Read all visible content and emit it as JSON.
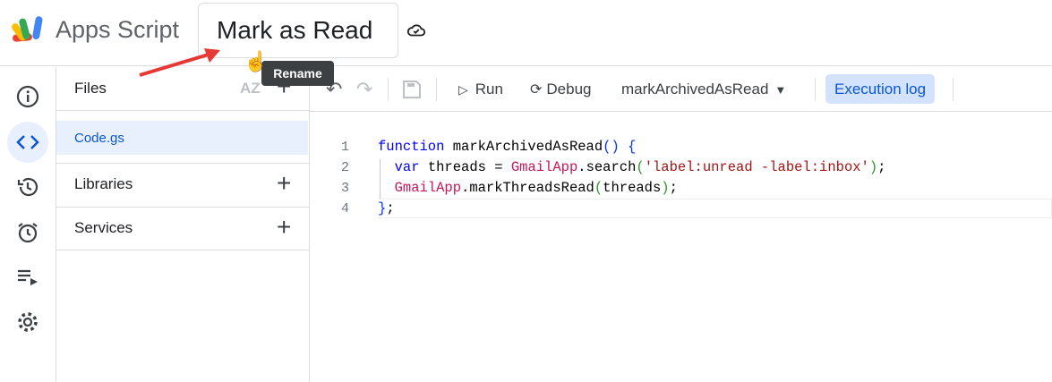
{
  "header": {
    "app_name": "Apps Script",
    "project_title": "Mark as Read",
    "tooltip": "Rename"
  },
  "sidebar": {
    "files_label": "Files",
    "sort_label": "AZ",
    "files": [
      {
        "name": "Code.gs",
        "selected": true
      }
    ],
    "libraries_label": "Libraries",
    "services_label": "Services"
  },
  "toolbar": {
    "run_label": "Run",
    "debug_label": "Debug",
    "function_select": "markArchivedAsRead",
    "execution_log_label": "Execution log"
  },
  "editor": {
    "line_numbers": [
      "1",
      "2",
      "3",
      "4"
    ],
    "lines": [
      [
        {
          "t": "function",
          "c": "kw"
        },
        {
          "t": " markArchivedAsRead",
          "c": ""
        },
        {
          "t": "()",
          "c": "pb"
        },
        {
          "t": " ",
          "c": ""
        },
        {
          "t": "{",
          "c": "pb"
        }
      ],
      [
        {
          "t": "  ",
          "c": ""
        },
        {
          "t": "var",
          "c": "kw"
        },
        {
          "t": " threads = ",
          "c": ""
        },
        {
          "t": "GmailApp",
          "c": "cls"
        },
        {
          "t": ".search",
          "c": ""
        },
        {
          "t": "(",
          "c": "pg"
        },
        {
          "t": "'label:unread -label:inbox'",
          "c": "str"
        },
        {
          "t": ")",
          "c": "pg"
        },
        {
          "t": ";",
          "c": ""
        }
      ],
      [
        {
          "t": "  ",
          "c": ""
        },
        {
          "t": "GmailApp",
          "c": "cls"
        },
        {
          "t": ".markThreadsRead",
          "c": ""
        },
        {
          "t": "(",
          "c": "pg"
        },
        {
          "t": "threads",
          "c": ""
        },
        {
          "t": ")",
          "c": "pg"
        },
        {
          "t": ";",
          "c": ""
        }
      ],
      [
        {
          "t": "}",
          "c": "pb"
        },
        {
          "t": ";",
          "c": ""
        }
      ]
    ]
  },
  "colors": {
    "accent": "#0b57d0",
    "selected_bg": "#e8f0fe",
    "annotation_arrow": "#e53935"
  }
}
